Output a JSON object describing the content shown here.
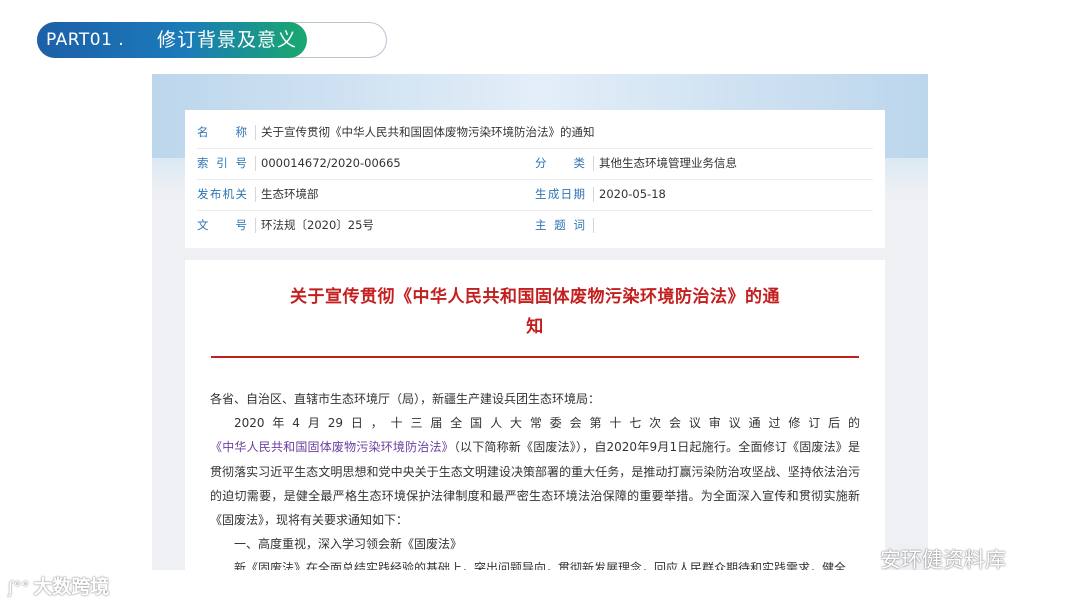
{
  "header": {
    "part_label": "PART01 .",
    "part_title": "修订背景及意义"
  },
  "info": {
    "name_key": "名 称",
    "name_value": "关于宣传贯彻《中华人民共和国固体废物污染环境防治法》的通知",
    "index_key": "索 引 号",
    "index_value": "000014672/2020-00665",
    "category_key": "分 类",
    "category_value": "其他生态环境管理业务信息",
    "issuer_key": "发布机关",
    "issuer_value": "生态环境部",
    "date_key": "生成日期",
    "date_value": "2020-05-18",
    "docno_key": "文 号",
    "docno_value": "环法规〔2020〕25号",
    "subject_key": "主 题 词",
    "subject_value": ""
  },
  "document": {
    "title_line1": "关于宣传贯彻《中华人民共和国固体废物污染环境防治法》的通",
    "title_line2": "知",
    "salutation": "各省、自治区、直辖市生态环境厅（局），新疆生产建设兵团生态环境局：",
    "p1_a": "2020年4月29日，十三届全国人大常委会第十七次会议审议通过修订后的",
    "p1_link": "《中华人民共和国固体废物污染环境防治法》",
    "p1_b": "（以下简称新《固废法》），自2020年9月1日起施行。全面修订《固废法》是贯彻落实习近平生态文明思想和党中央关于生态文明建设决策部署的重大任务，是推动打赢污染防治攻坚战、坚持依法治污的迫切需要，是健全最严格生态环境保护法律制度和最严密生态环境法治保障的重要举措。为全面深入宣传和贯彻实施新《固废法》，现将有关要求通知如下：",
    "section1": "一、高度重视，深入学习领会新《固废法》",
    "p2": "新《固废法》在全面总结实践经验的基础上，突出问题导向，贯彻新发展理念，回应人民群众期待和实践需求，健全"
  },
  "watermarks": {
    "left": "大数跨境",
    "right": "安环健资料库"
  },
  "colors": {
    "accent_blue": "#1d5fa8",
    "accent_green": "#19a86e",
    "title_red": "#c41f1f",
    "key_blue": "#2d74b5"
  }
}
